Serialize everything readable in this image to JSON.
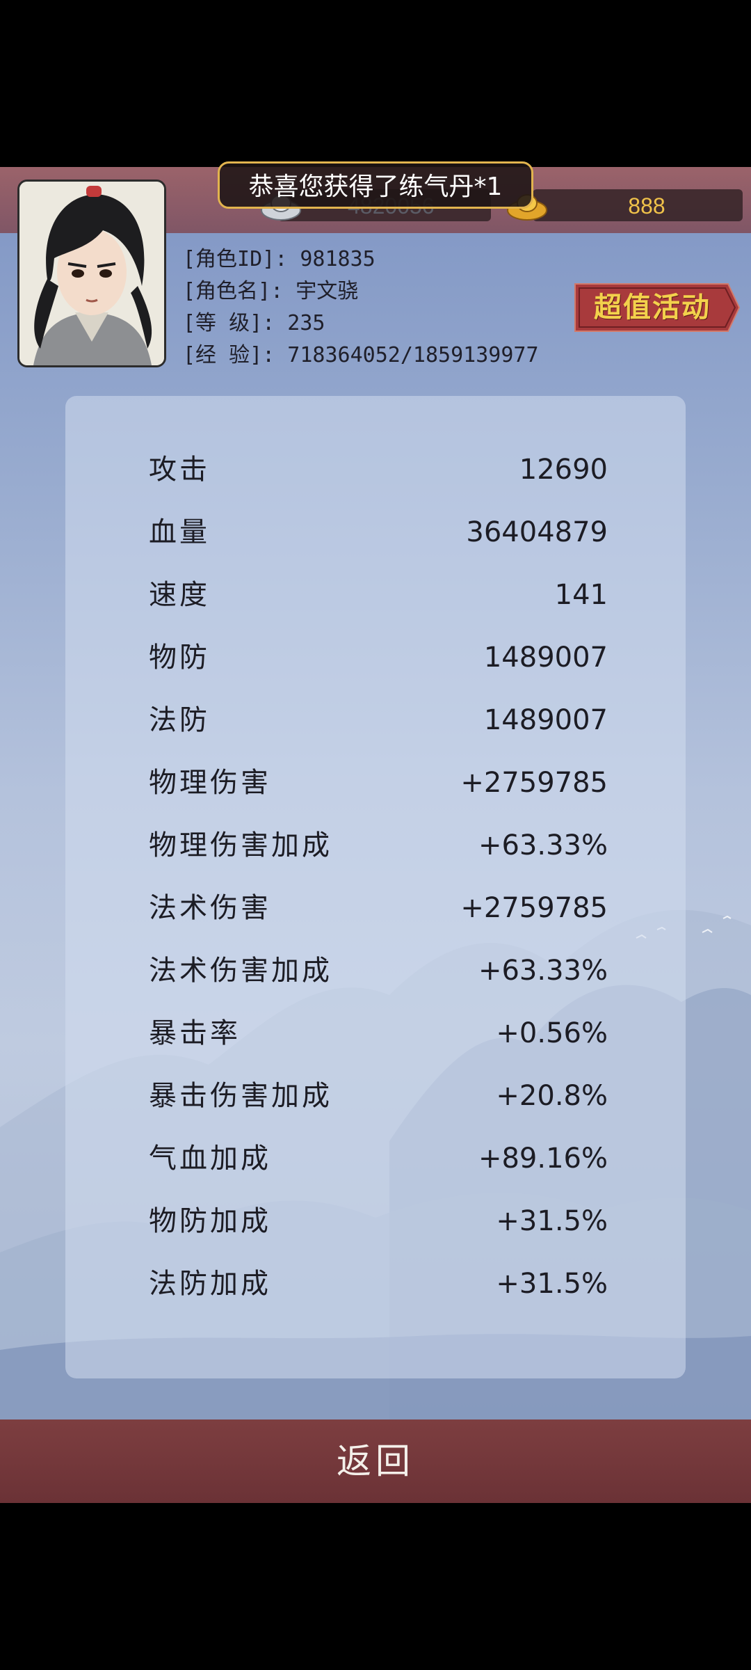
{
  "toast": {
    "message": "恭喜您获得了练气丹*1"
  },
  "currency": {
    "silver_value": "4820056",
    "gold_value": "888"
  },
  "character": {
    "id_line": "[角色ID]: 981835",
    "name_line": "[角色名]: 宇文骁",
    "level_line": "[等  级]: 235",
    "exp_line": "[经  验]: 718364052/1859139977"
  },
  "promo": {
    "label": "超值活动"
  },
  "stats": [
    {
      "name": "攻击",
      "value": "12690"
    },
    {
      "name": "血量",
      "value": "36404879"
    },
    {
      "name": "速度",
      "value": "141"
    },
    {
      "name": "物防",
      "value": "1489007"
    },
    {
      "name": "法防",
      "value": "1489007"
    },
    {
      "name": "物理伤害",
      "value": "+2759785"
    },
    {
      "name": "物理伤害加成",
      "value": "+63.33%"
    },
    {
      "name": "法术伤害",
      "value": "+2759785"
    },
    {
      "name": "法术伤害加成",
      "value": "+63.33%"
    },
    {
      "name": "暴击率",
      "value": "+0.56%"
    },
    {
      "name": "暴击伤害加成",
      "value": "+20.8%"
    },
    {
      "name": "气血加成",
      "value": "+89.16%"
    },
    {
      "name": "物防加成",
      "value": "+31.5%"
    },
    {
      "name": "法防加成",
      "value": "+31.5%"
    }
  ],
  "footer": {
    "back_label": "返回"
  },
  "colors": {
    "accent_gold": "#f3d14c",
    "bar_red": "#7d3e40",
    "toast_border": "#e2b44e"
  },
  "icons": {
    "silver": "silver-ingot-icon",
    "gold": "gold-ingot-icon"
  }
}
